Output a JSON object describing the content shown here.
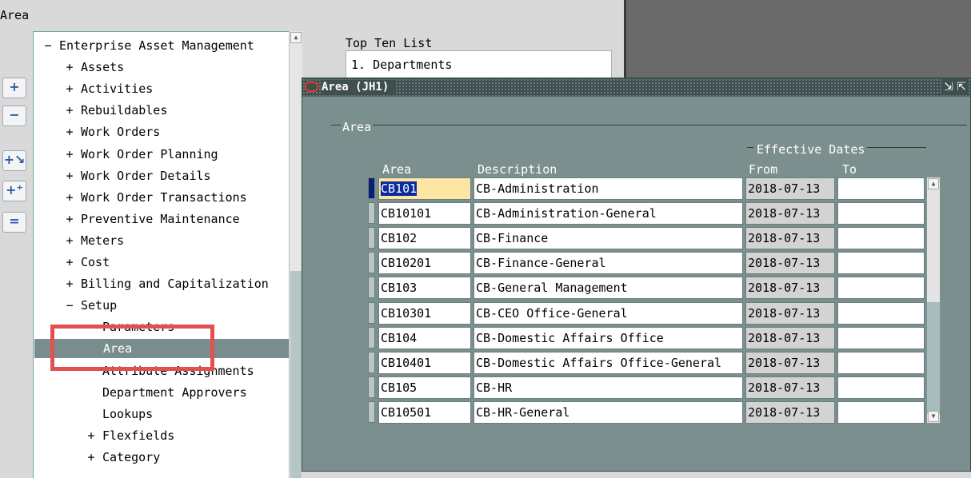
{
  "page": {
    "title": "Area"
  },
  "navigator": {
    "tools": [
      {
        "glyph": "+",
        "name": "expand-icon"
      },
      {
        "glyph": "−",
        "name": "collapse-icon"
      },
      {
        "glyph": "+↘",
        "name": "expand-branch-icon"
      },
      {
        "glyph": "+⁺",
        "name": "expand-all-icon"
      },
      {
        "glyph": "=",
        "name": "collapse-all-icon"
      }
    ],
    "tree": [
      {
        "sign": "−",
        "label": "Enterprise Asset Management",
        "level": 0
      },
      {
        "sign": "+",
        "label": "Assets",
        "level": 1
      },
      {
        "sign": "+",
        "label": "Activities",
        "level": 1
      },
      {
        "sign": "+",
        "label": "Rebuildables",
        "level": 1
      },
      {
        "sign": "+",
        "label": "Work Orders",
        "level": 1
      },
      {
        "sign": "+",
        "label": "Work Order Planning",
        "level": 1
      },
      {
        "sign": "+",
        "label": "Work Order Details",
        "level": 1
      },
      {
        "sign": "+",
        "label": "Work Order Transactions",
        "level": 1
      },
      {
        "sign": "+",
        "label": "Preventive Maintenance",
        "level": 1
      },
      {
        "sign": "+",
        "label": "Meters",
        "level": 1
      },
      {
        "sign": "+",
        "label": "Cost",
        "level": 1
      },
      {
        "sign": "+",
        "label": "Billing and Capitalization",
        "level": 1
      },
      {
        "sign": "−",
        "label": "Setup",
        "level": 1
      },
      {
        "sign": "",
        "label": "Parameters",
        "level": 2
      },
      {
        "sign": "",
        "label": "Area",
        "level": 2,
        "selected": true
      },
      {
        "sign": "",
        "label": "Attribute Assignments",
        "level": 2
      },
      {
        "sign": "",
        "label": "Department Approvers",
        "level": 2
      },
      {
        "sign": "",
        "label": "Lookups",
        "level": 2
      },
      {
        "sign": "+",
        "label": "Flexfields",
        "level": 2
      },
      {
        "sign": "+",
        "label": "Category",
        "level": 2
      }
    ]
  },
  "top_ten": {
    "label": "Top Ten List",
    "items": [
      "1. Departments"
    ]
  },
  "area_window": {
    "title": "Area (JH1)",
    "controls": "⇲ ⇱",
    "section_label": "Area",
    "effective_dates_label": "Effective Dates",
    "columns": {
      "area": "Area",
      "description": "Description",
      "from": "From",
      "to": "To"
    },
    "rows": [
      {
        "area": "CB101",
        "description": "CB-Administration",
        "from": "2018-07-13",
        "to": ""
      },
      {
        "area": "CB10101",
        "description": "CB-Administration-General",
        "from": "2018-07-13",
        "to": ""
      },
      {
        "area": "CB102",
        "description": "CB-Finance",
        "from": "2018-07-13",
        "to": ""
      },
      {
        "area": "CB10201",
        "description": "CB-Finance-General",
        "from": "2018-07-13",
        "to": ""
      },
      {
        "area": "CB103",
        "description": "CB-General Management",
        "from": "2018-07-13",
        "to": ""
      },
      {
        "area": "CB10301",
        "description": "CB-CEO Office-General",
        "from": "2018-07-13",
        "to": ""
      },
      {
        "area": "CB104",
        "description": "CB-Domestic Affairs Office",
        "from": "2018-07-13",
        "to": ""
      },
      {
        "area": "CB10401",
        "description": "CB-Domestic Affairs Office-General",
        "from": "2018-07-13",
        "to": ""
      },
      {
        "area": "CB105",
        "description": "CB-HR",
        "from": "2018-07-13",
        "to": ""
      },
      {
        "area": "CB10501",
        "description": "CB-HR-General",
        "from": "2018-07-13",
        "to": ""
      }
    ]
  },
  "colors": {
    "window_bg": "#7c8f8f",
    "highlight": "#e35050",
    "selected_row": "#7a8d8e"
  }
}
